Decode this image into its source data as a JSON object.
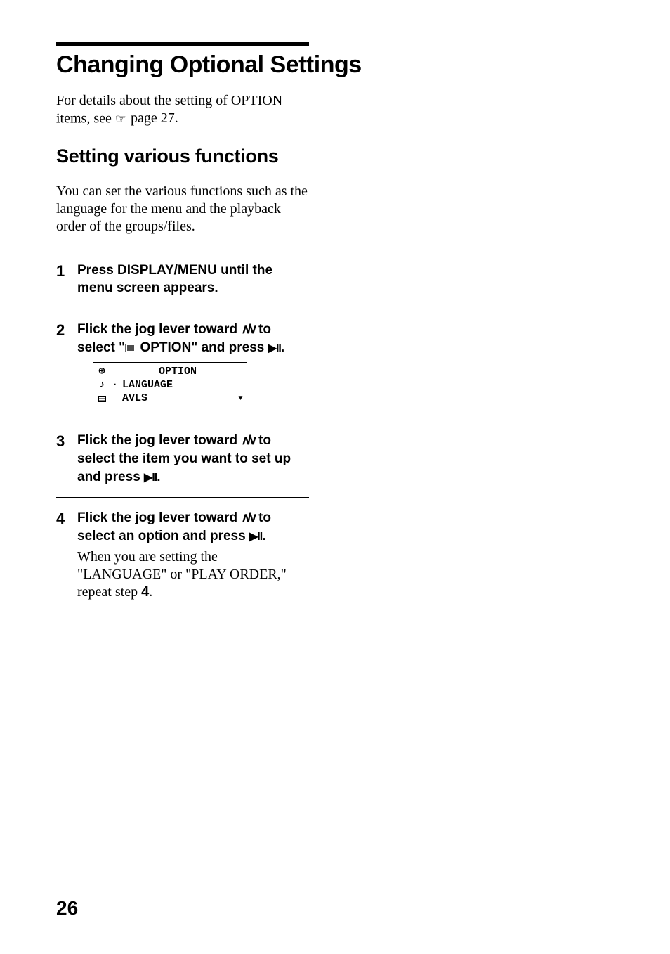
{
  "title": "Changing Optional Settings",
  "intro_pre": "For details about the setting of OPTION items, see ",
  "intro_page_ref": " page 27.",
  "subheading": "Setting various functions",
  "sub_intro": "You can set the various functions such as the language for the menu and the playback order of the groups/files.",
  "glyphs": {
    "up": "∧",
    "down": "∨",
    "play": "▶",
    "pause": "II",
    "slash": "/",
    "option_icon": "☰",
    "hand": "☞"
  },
  "steps": [
    {
      "num": "1",
      "title": "Press DISPLAY/MENU until the menu screen appears."
    },
    {
      "num": "2",
      "title_pre": "Flick the jog lever toward ",
      "title_mid": " to select \"",
      "title_post": " OPTION\" and press ",
      "title_end": "."
    },
    {
      "num": "3",
      "title_pre": "Flick the jog lever toward ",
      "title_mid": " to select the item you want to set up and press ",
      "title_end": "."
    },
    {
      "num": "4",
      "title_pre": "Flick the jog lever toward ",
      "title_mid": " to select an option and press ",
      "title_end": ".",
      "note_pre": "When you are setting the \"LANGUAGE\" or \"PLAY ORDER,\" repeat step ",
      "note_step": "4",
      "note_post": "."
    }
  ],
  "lcd": {
    "line1": "OPTION",
    "line2": "LANGUAGE",
    "line3": "AVLS",
    "icon1": "⊕",
    "icon2": "♪",
    "icon3": "■",
    "bullet": "∙",
    "scroll_down": "▾"
  },
  "page_number": "26"
}
